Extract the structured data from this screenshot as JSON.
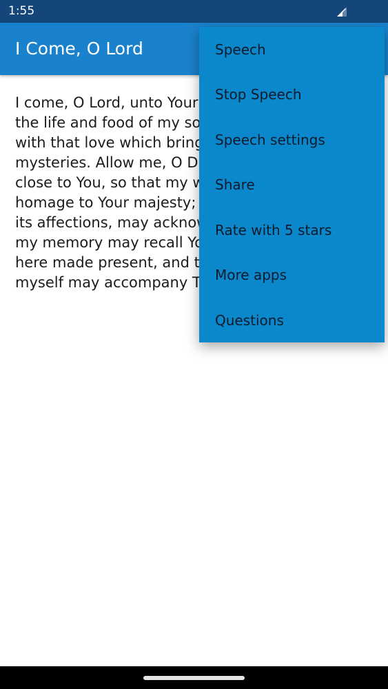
{
  "status_bar": {
    "time": "1:55",
    "signal_icon": "signal-icon"
  },
  "app_bar": {
    "title": "I Come, O Lord"
  },
  "content": {
    "text": "I come, O Lord, unto Your table to receive You, the life and food of my soul. O Lord, inspire me with that love which brings me to Your holy mysteries. Allow me, O Divine Jesus, to come close to You, so that my whole soul may do homage to Your majesty; that my heart, with all its affections, may acknowledge Your love; that my memory may recall Your admirable mysteries here made present, and that the sacrifice of myself may accompany Thine."
  },
  "overflow_menu": {
    "items": [
      "Speech",
      "Stop Speech",
      "Speech settings",
      "Share",
      "Rate with 5 stars",
      "More apps",
      "Questions"
    ]
  },
  "colors": {
    "status_bar": "#14467a",
    "app_bar": "#1a82cc",
    "menu": "#0b87cc"
  }
}
